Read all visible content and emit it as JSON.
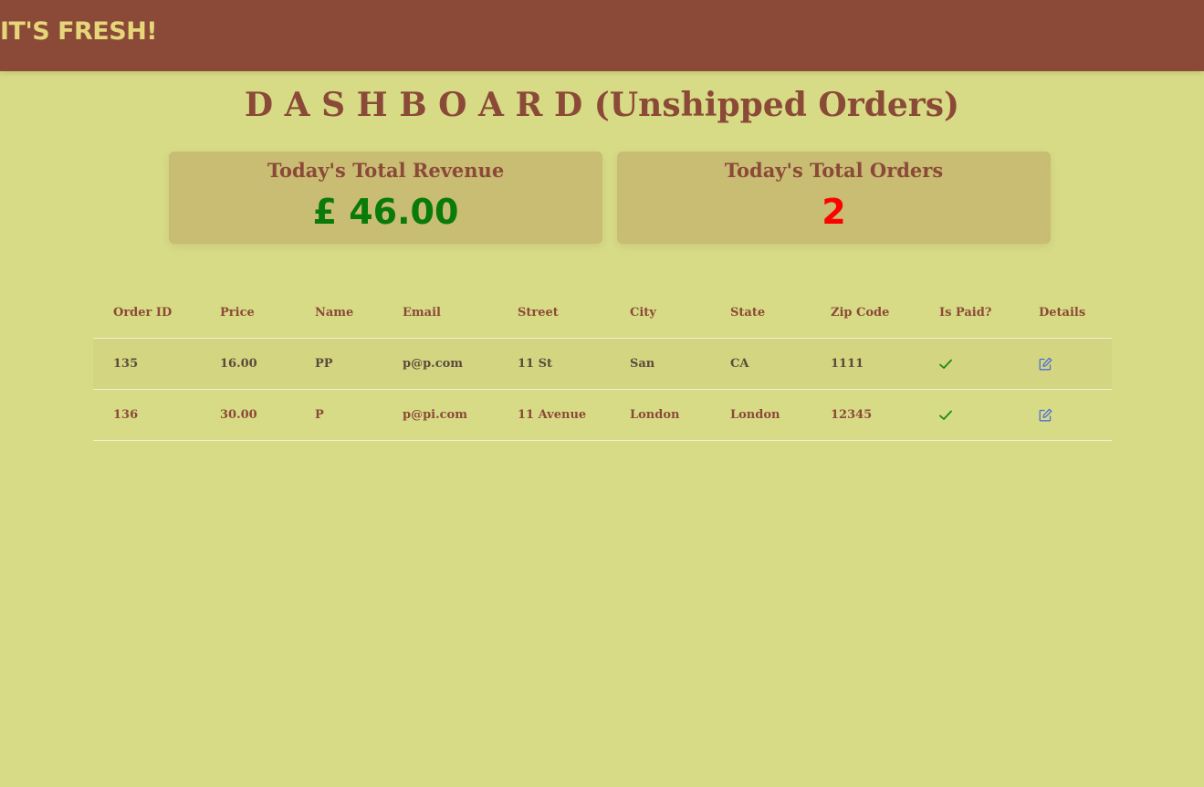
{
  "navbar": {
    "brand": "IT'S FRESH!"
  },
  "page": {
    "title": "D A S H B O A R D (Unshipped Orders)"
  },
  "cards": {
    "revenue_label": "Today's Total Revenue",
    "revenue_value": "£ 46.00",
    "orders_label": "Today's Total Orders",
    "orders_value": "2"
  },
  "colors": {
    "background": "#d8db86",
    "navbar": "#8b4a38",
    "brand_text": "#e6d67a",
    "revenue_value": "#0a7a0a",
    "orders_value": "#ff0000",
    "check": "#1a8a1a",
    "edit": "#4b6fd6"
  },
  "table": {
    "columns": [
      "Order ID",
      "Price",
      "Name",
      "Email",
      "Street",
      "City",
      "State",
      "Zip Code",
      "Is Paid?",
      "Details"
    ],
    "rows": [
      {
        "order_id": "135",
        "price": "16.00",
        "name": "PP",
        "email": "p@p.com",
        "street": "11 St",
        "city": "San",
        "state": "CA",
        "zip": "1111",
        "is_paid_icon": "check-icon",
        "details_icon": "edit-icon"
      },
      {
        "order_id": "136",
        "price": "30.00",
        "name": "P",
        "email": "p@pi.com",
        "street": "11 Avenue",
        "city": "London",
        "state": "London",
        "zip": "12345",
        "is_paid_icon": "check-icon",
        "details_icon": "edit-icon"
      }
    ]
  }
}
